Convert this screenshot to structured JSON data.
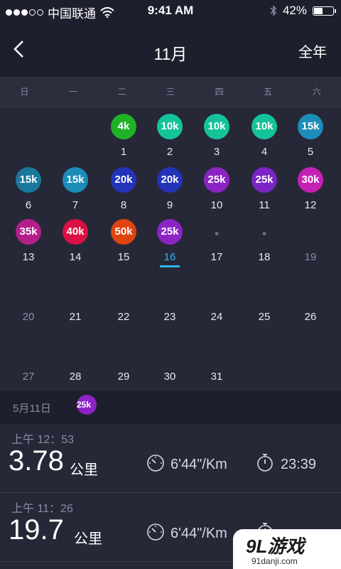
{
  "status_bar": {
    "carrier": "中国联通",
    "time": "9:41 AM",
    "battery": "42%",
    "battery_level": 0.42
  },
  "nav": {
    "title": "11月",
    "right_label": "全年"
  },
  "weekdays": [
    "日",
    "一",
    "二",
    "三",
    "四",
    "五",
    "六"
  ],
  "calendar_days": [
    {
      "day": "1",
      "badge": "4k",
      "color": "#1fb227"
    },
    {
      "day": "2",
      "badge": "10k",
      "color": "#14c39a"
    },
    {
      "day": "3",
      "badge": "10k",
      "color": "#14c39a"
    },
    {
      "day": "4",
      "badge": "10k",
      "color": "#14c39a"
    },
    {
      "day": "5",
      "badge": "15k",
      "color": "#1c8db9"
    },
    {
      "day": "6",
      "badge": "15k",
      "color": "#1a789b"
    },
    {
      "day": "7",
      "badge": "15k",
      "color": "#1c8db9"
    },
    {
      "day": "8",
      "badge": "20k",
      "color": "#2334b8"
    },
    {
      "day": "9",
      "badge": "20k",
      "color": "#2334b8"
    },
    {
      "day": "10",
      "badge": "25k",
      "color": "#8c24c4"
    },
    {
      "day": "11",
      "badge": "25k",
      "color": "#7a24c4"
    },
    {
      "day": "12",
      "badge": "30k",
      "color": "#c421b4"
    },
    {
      "day": "13",
      "badge": "35k",
      "color": "#b31f88"
    },
    {
      "day": "14",
      "badge": "40k",
      "color": "#db1043"
    },
    {
      "day": "15",
      "badge": "50k",
      "color": "#e0440e"
    },
    {
      "day": "16",
      "badge": "25k",
      "color": "#8c24c4",
      "today": true
    },
    {
      "day": "17",
      "dot": true
    },
    {
      "day": "18",
      "dot": true
    },
    {
      "day": "19",
      "future": true
    },
    {
      "day": "20",
      "future": true
    },
    {
      "day": "21"
    },
    {
      "day": "22"
    },
    {
      "day": "23"
    },
    {
      "day": "24"
    },
    {
      "day": "25"
    },
    {
      "day": "26"
    },
    {
      "day": "27",
      "future": true
    },
    {
      "day": "28"
    },
    {
      "day": "29"
    },
    {
      "day": "30"
    },
    {
      "day": "31"
    }
  ],
  "first_weekday": 2,
  "day_header": {
    "date": "5月11日",
    "badge": "25k"
  },
  "runs": [
    {
      "time": "上午 12：53",
      "distance": "3.78",
      "unit": "公里",
      "pace": "6'44\"/Km",
      "duration": "23:39"
    },
    {
      "time": "上午 11：26",
      "distance": "19.7",
      "unit": "公里",
      "pace": "6'44\"/Km",
      "duration": ""
    }
  ],
  "watermark": {
    "main": "9L游戏",
    "sub": "91danji.com"
  }
}
